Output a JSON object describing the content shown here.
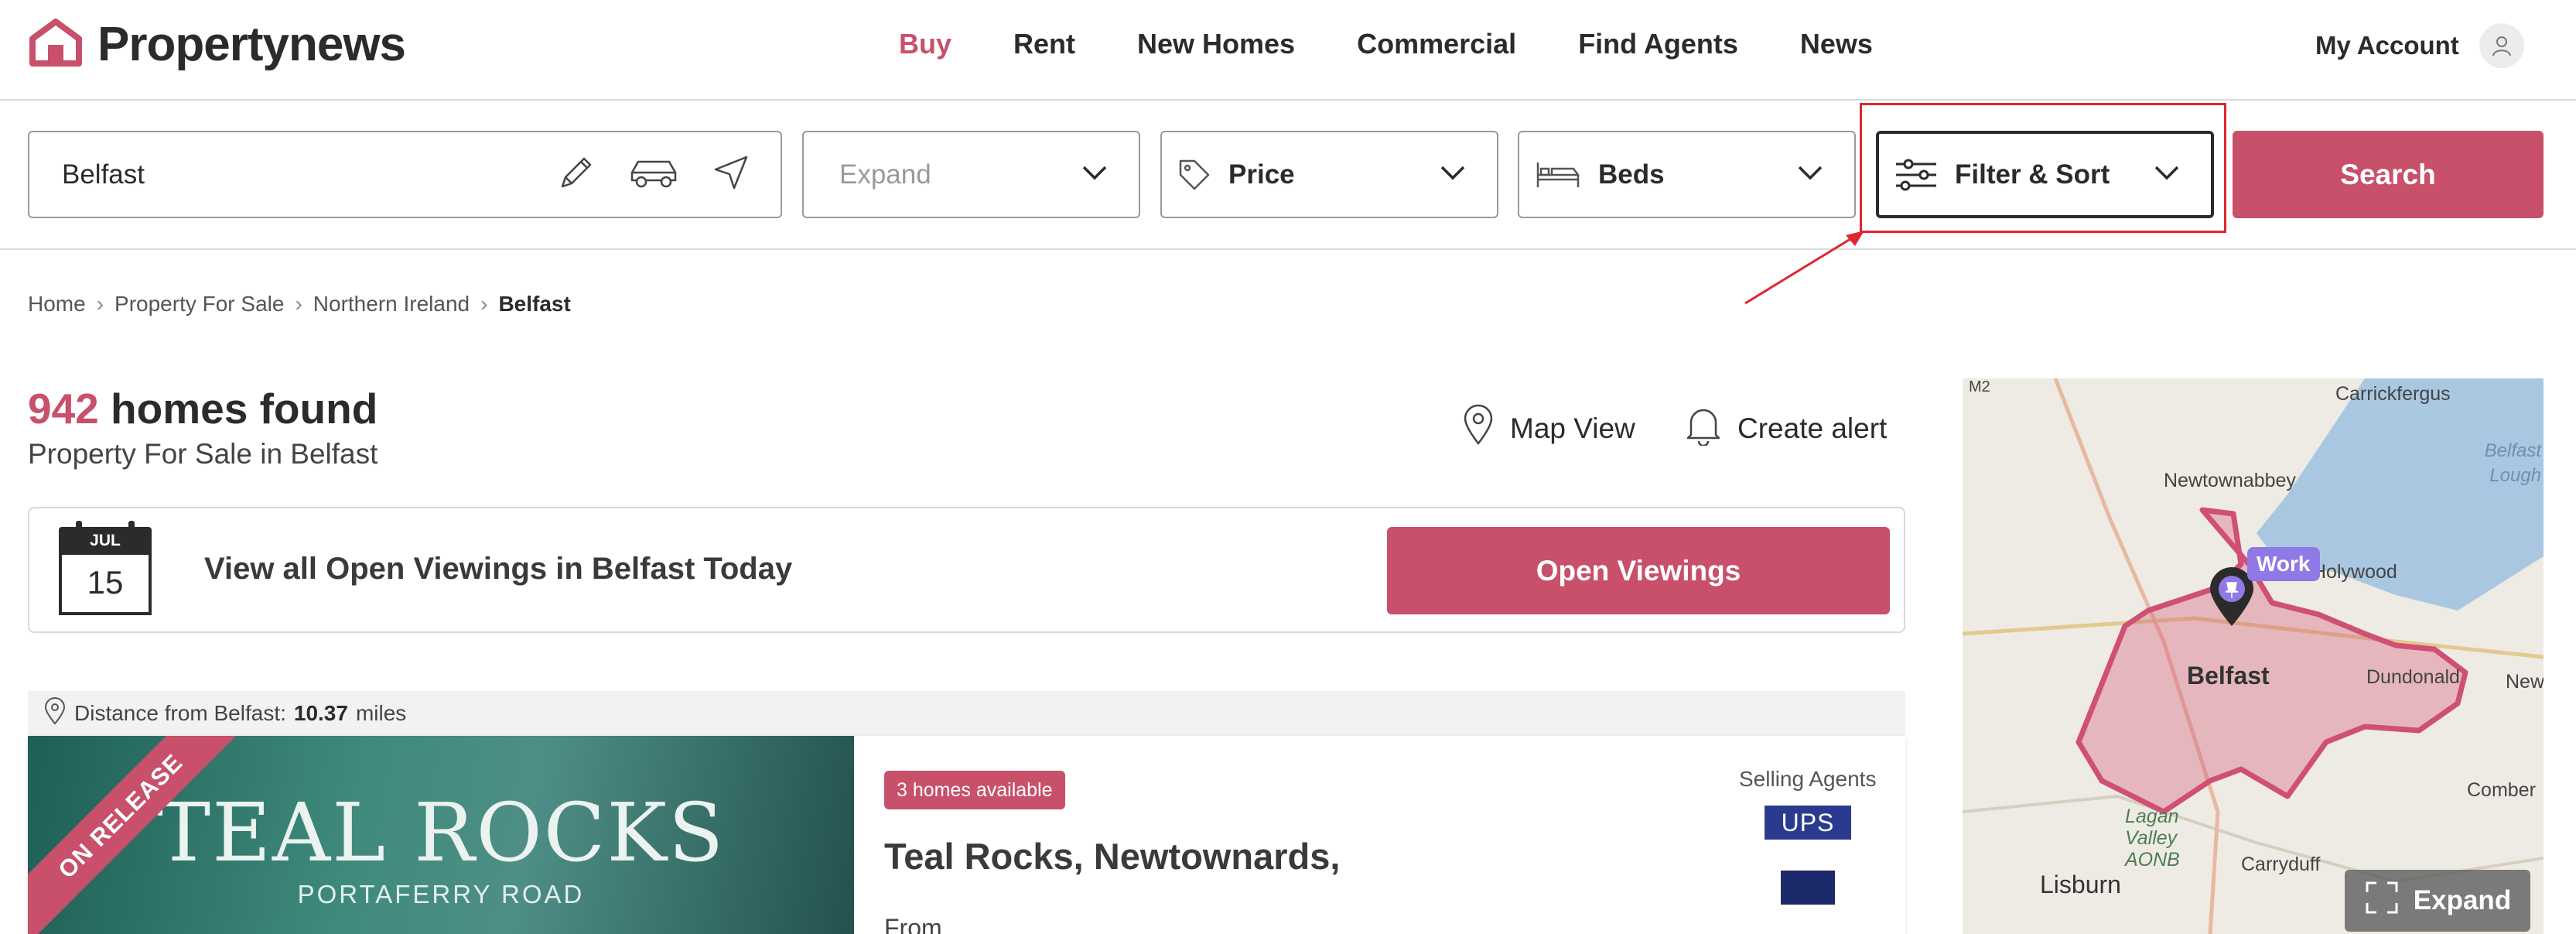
{
  "header": {
    "brand": "Propertynews",
    "nav": [
      {
        "label": "Buy",
        "active": true
      },
      {
        "label": "Rent"
      },
      {
        "label": "New Homes"
      },
      {
        "label": "Commercial"
      },
      {
        "label": "Find Agents"
      },
      {
        "label": "News"
      }
    ],
    "account_label": "My Account"
  },
  "search": {
    "location_value": "Belfast",
    "expand_placeholder": "Expand",
    "price_label": "Price",
    "beds_label": "Beds",
    "filter_label": "Filter & Sort",
    "search_button": "Search"
  },
  "breadcrumb": [
    "Home",
    "Property For Sale",
    "Northern Ireland",
    "Belfast"
  ],
  "results": {
    "count": "942",
    "count_suffix": "homes found",
    "subtitle": "Property For Sale in Belfast",
    "map_view": "Map View",
    "create_alert": "Create alert"
  },
  "viewings": {
    "cal_month": "JUL",
    "cal_day": "15",
    "text": "View all Open Viewings in Belfast Today",
    "button": "Open Viewings"
  },
  "listing": {
    "distance_prefix": "Distance from Belfast:",
    "distance_value": "10.37",
    "distance_unit": "miles",
    "ribbon": "ON RELEASE",
    "image_title": "TEAL ROCKS",
    "image_subtitle": "PORTAFERRY ROAD",
    "badge": "3 homes available",
    "title": "Teal Rocks, Newtownards,",
    "from_label": "From",
    "agents_label": "Selling Agents",
    "agent_logo_text": "UPS"
  },
  "map": {
    "labels": {
      "m2": "M2",
      "carrickfergus": "Carrickfergus",
      "newtownabbey": "Newtownabbey",
      "belfast_lough": "Belfast Lough",
      "holywood": "Holywood",
      "belfast": "Belfast",
      "dundonald": "Dundonald",
      "newt": "Newt",
      "comber": "Comber",
      "lagan": "Lagan Valley AONB",
      "carryduff": "Carryduff",
      "lisburn": "Lisburn"
    },
    "work_tag": "Work",
    "expand_button": "Expand"
  },
  "colors": {
    "brand": "#c8506a",
    "text": "#2b2b2b",
    "highlight": "#e0262f",
    "work_pin": "#8e79e6"
  }
}
